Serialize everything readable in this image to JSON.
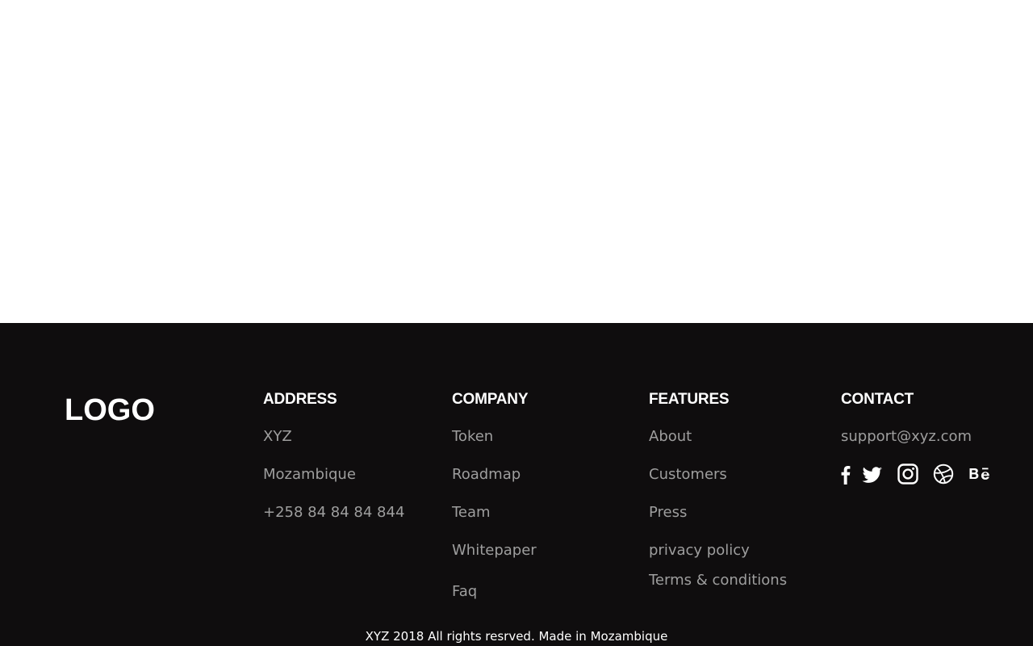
{
  "footer": {
    "logo": "LOGO",
    "address": {
      "title": "ADDRESS",
      "lines": [
        "XYZ",
        "Mozambique",
        "+258 84 84 84 844"
      ]
    },
    "company": {
      "title": "COMPANY",
      "links": [
        "Token",
        "Roadmap",
        "Team",
        "Whitepaper",
        "Faq"
      ]
    },
    "features": {
      "title": "FEATURES",
      "links": [
        "About",
        "Customers",
        "Press",
        "privacy policy",
        "Terms & conditions"
      ]
    },
    "contact": {
      "title": "CONTACT",
      "email": "support@xyz.com",
      "social_icons": [
        "facebook-icon",
        "twitter-icon",
        "instagram-icon",
        "dribbble-icon",
        "behance-icon"
      ]
    },
    "copyright": "XYZ 2018 All rights resrved. Made in Mozambique",
    "colors": {
      "background": "#0f0d0e",
      "heading": "#ffffff",
      "link": "#9e9e9e"
    }
  }
}
